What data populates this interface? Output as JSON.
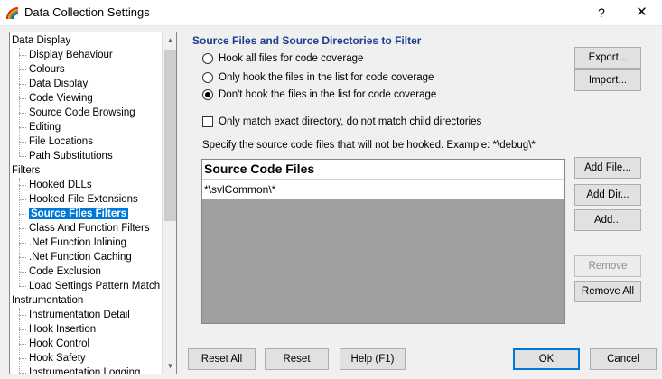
{
  "window": {
    "title": "Data Collection Settings",
    "help": "?",
    "close": "✕",
    "icon": "rainbow-app-icon"
  },
  "tree": {
    "items": [
      {
        "label": "Data Display",
        "level": 0
      },
      {
        "label": "Display Behaviour",
        "level": 1
      },
      {
        "label": "Colours",
        "level": 1
      },
      {
        "label": "Data Display",
        "level": 1
      },
      {
        "label": "Code Viewing",
        "level": 1
      },
      {
        "label": "Source Code Browsing",
        "level": 1
      },
      {
        "label": "Editing",
        "level": 1
      },
      {
        "label": "File Locations",
        "level": 1
      },
      {
        "label": "Path Substitutions",
        "level": 1
      },
      {
        "label": "Filters",
        "level": 0
      },
      {
        "label": "Hooked DLLs",
        "level": 1
      },
      {
        "label": "Hooked File Extensions",
        "level": 1
      },
      {
        "label": "Source Files Filters",
        "level": 1,
        "selected": true
      },
      {
        "label": "Class And Function Filters",
        "level": 1
      },
      {
        "label": ".Net Function Inlining",
        "level": 1
      },
      {
        "label": ".Net Function Caching",
        "level": 1
      },
      {
        "label": "Code Exclusion",
        "level": 1
      },
      {
        "label": "Load Settings Pattern Match",
        "level": 1
      },
      {
        "label": "Instrumentation",
        "level": 0
      },
      {
        "label": "Instrumentation Detail",
        "level": 1
      },
      {
        "label": "Hook Insertion",
        "level": 1
      },
      {
        "label": "Hook Control",
        "level": 1
      },
      {
        "label": "Hook Safety",
        "level": 1
      },
      {
        "label": "Instrumentation Logging",
        "level": 1
      }
    ],
    "scroll_up": "▲",
    "scroll_down": "▼"
  },
  "panel": {
    "title": "Source Files and Source Directories to Filter",
    "radios": [
      {
        "label": "Hook all files for code coverage",
        "checked": false
      },
      {
        "label": "Only hook the files in the list for code coverage",
        "checked": false
      },
      {
        "label": "Don't hook the files in the list for code coverage",
        "checked": true
      }
    ],
    "checkbox": {
      "label": "Only match exact directory, do not match child directories",
      "checked": false
    },
    "hint": "Specify the source code files that will not be hooked. Example: *\\debug\\*",
    "list": {
      "header": "Source Code Files",
      "rows": [
        "*\\svlCommon\\*"
      ]
    }
  },
  "buttons": {
    "export": "Export...",
    "import": "Import...",
    "add_file": "Add File...",
    "add_dir": "Add Dir...",
    "add": "Add...",
    "remove": "Remove",
    "remove_all": "Remove All",
    "reset_all": "Reset All",
    "reset": "Reset",
    "help": "Help (F1)",
    "ok": "OK",
    "cancel": "Cancel"
  }
}
